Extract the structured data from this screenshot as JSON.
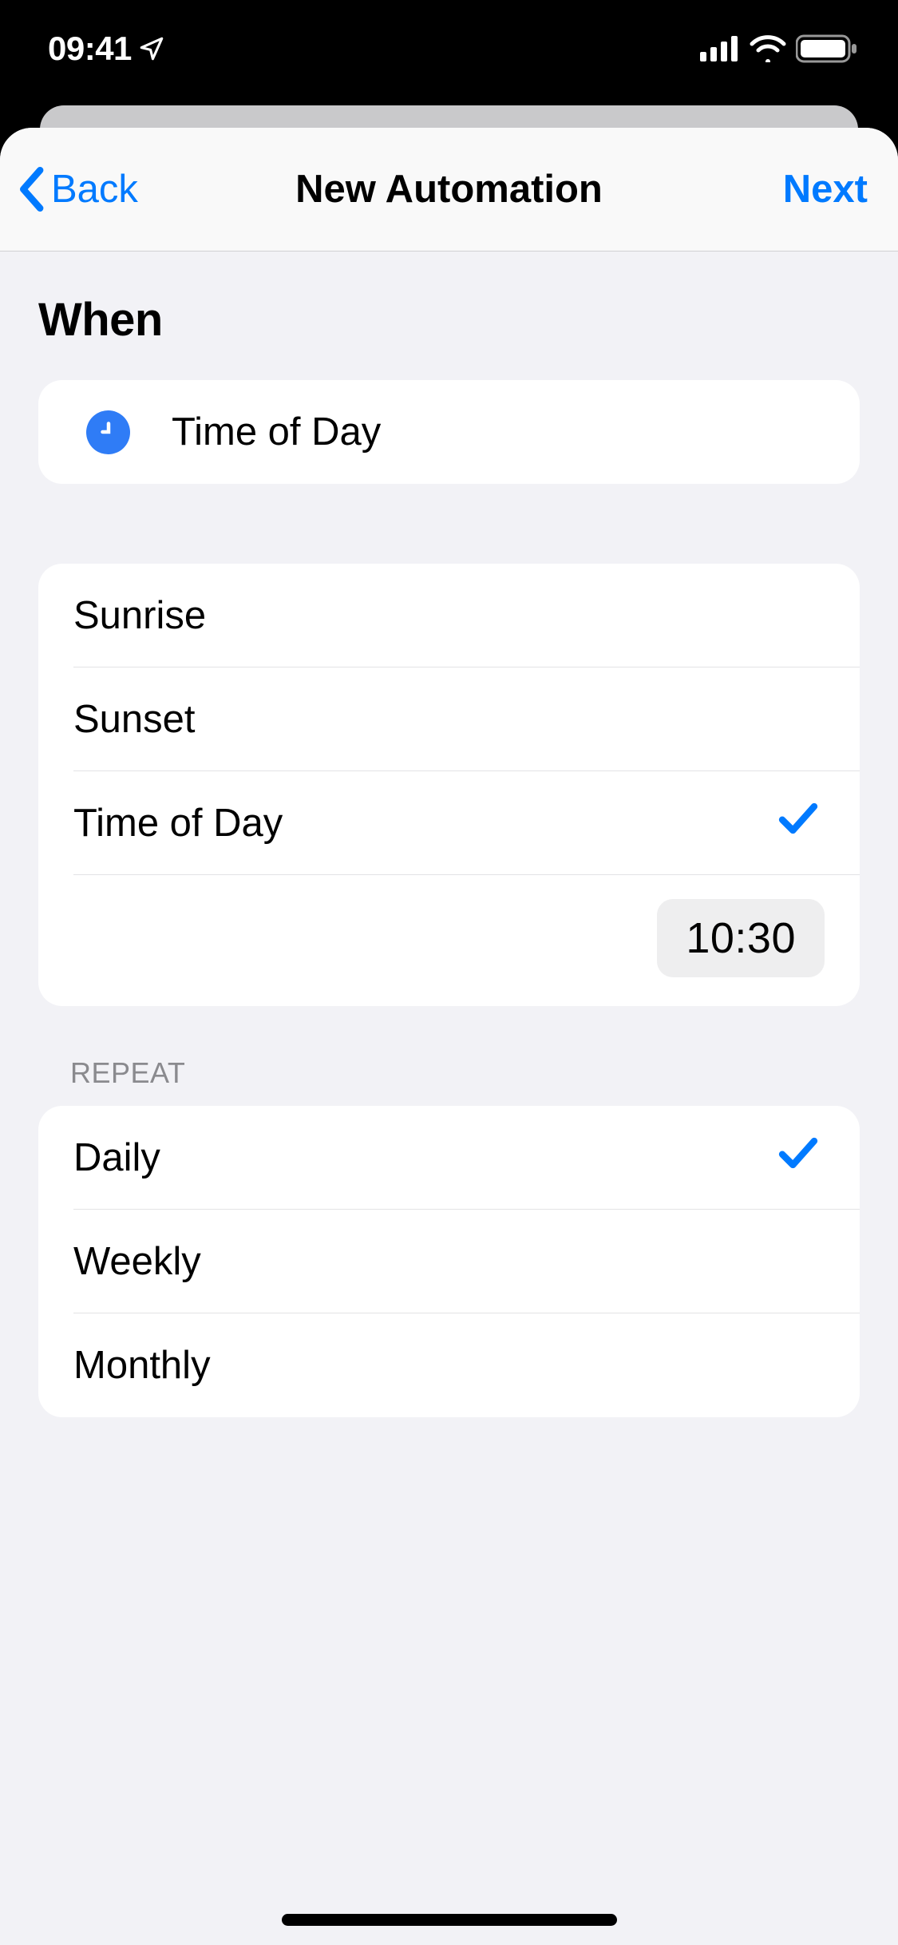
{
  "status": {
    "time": "09:41"
  },
  "nav": {
    "back": "Back",
    "title": "New Automation",
    "next": "Next"
  },
  "when": {
    "title": "When",
    "header": "Time of Day"
  },
  "timeOptions": {
    "items": [
      "Sunrise",
      "Sunset",
      "Time of Day"
    ],
    "selectedIndex": 2,
    "timeValue": "10:30"
  },
  "repeat": {
    "header": "REPEAT",
    "items": [
      "Daily",
      "Weekly",
      "Monthly"
    ],
    "selectedIndex": 0
  }
}
